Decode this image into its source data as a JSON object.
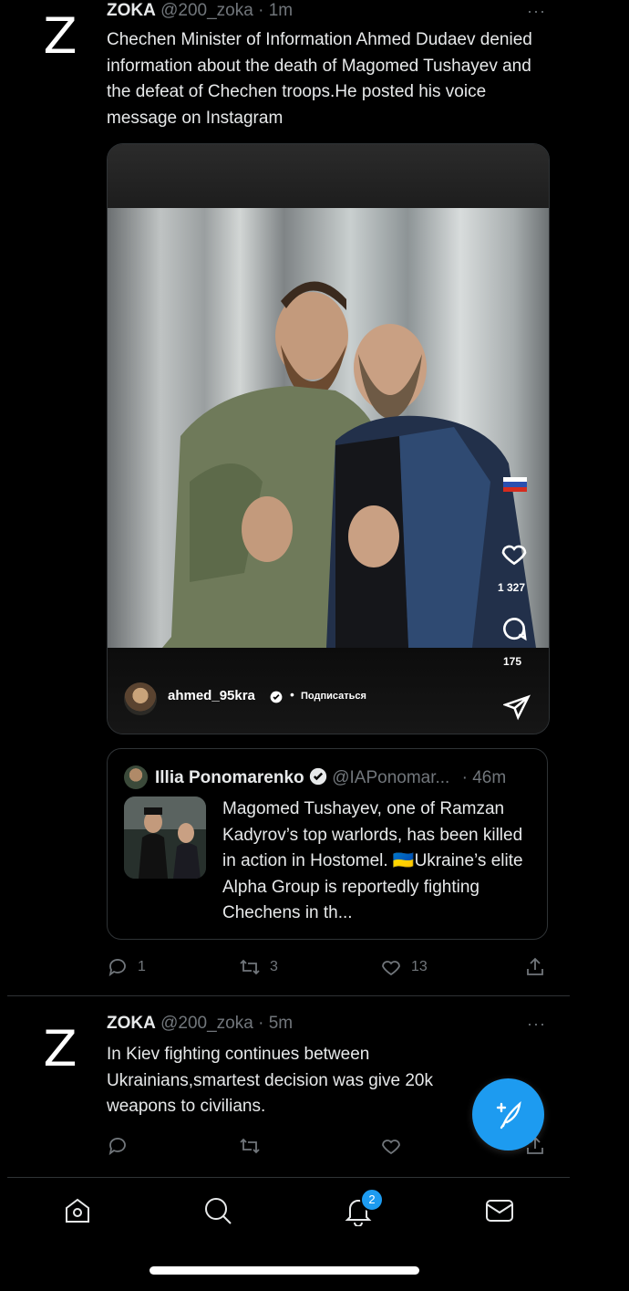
{
  "tweet1": {
    "avatar_letter": "Z",
    "name": "ZOKA",
    "handle": "@200_zoka",
    "dot": "·",
    "time": "1m",
    "more": "···",
    "text": "Chechen Minister of Information Ahmed Dudaev denied information about the death of Magomed Tushayev and the defeat of Chechen troops.He posted his voice message on Instagram",
    "media": {
      "likes": "1 327",
      "comments": "175",
      "username": "ahmed_95kra",
      "follow": "Подписаться"
    },
    "quote": {
      "name": "Illia Ponomarenko",
      "handle": "@IAPonomar...",
      "time": "· 46m",
      "text": "Magomed Tushayev, one of Ramzan Kadyrov’s top warlords, has been killed in action in Hostomel. 🇺🇦Ukraine’s elite Alpha Group is reportedly fighting Chechens in th..."
    },
    "actions": {
      "replies": "1",
      "retweets": "3",
      "likes": "13"
    }
  },
  "tweet2": {
    "avatar_letter": "Z",
    "name": "ZOKA",
    "handle": "@200_zoka",
    "dot": "·",
    "time": "5m",
    "more": "···",
    "text": "In Kiev fighting continues between Ukrainians,smartest decision was give 20k weapons to civilians."
  },
  "nav": {
    "notifications_badge": "2"
  },
  "colors": {
    "accent": "#1d9bf0",
    "muted": "#71767b",
    "background": "#000000"
  }
}
